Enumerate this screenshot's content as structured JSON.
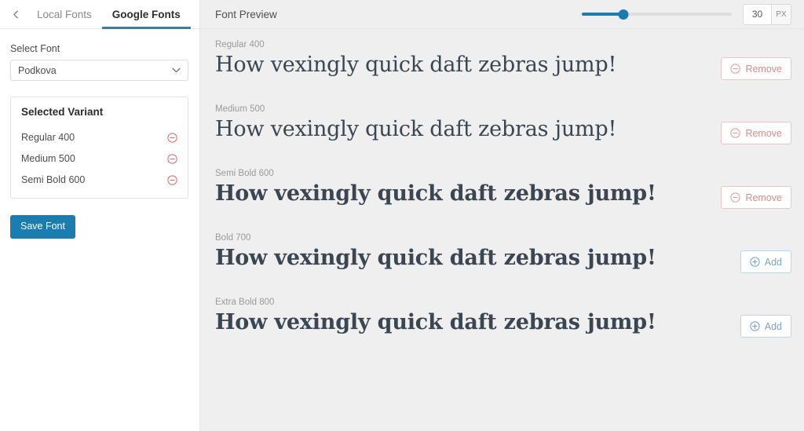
{
  "sidebar": {
    "back_icon": "chevron-left-icon",
    "tabs": [
      {
        "label": "Local Fonts",
        "active": false
      },
      {
        "label": "Google Fonts",
        "active": true
      }
    ],
    "select_font": {
      "label": "Select Font",
      "value": "Podkova",
      "placeholder": "Select Font",
      "chevron_icon": "chevron-down-icon"
    },
    "selected_variant": {
      "title": "Selected Variant",
      "remove_icon": "minus-circle-icon",
      "items": [
        {
          "label": "Regular 400"
        },
        {
          "label": "Medium 500"
        },
        {
          "label": "Semi Bold 600"
        }
      ]
    },
    "save_button": "Save Font"
  },
  "main": {
    "title": "Font Preview",
    "size_control": {
      "value": "30",
      "unit": "PX",
      "min": 0,
      "max": 100,
      "slider_percent": 28,
      "accent": "#1b7cb0"
    },
    "sample_text": "How vexingly quick daft zebras jump!",
    "add_label": "Add",
    "remove_label": "Remove",
    "add_icon": "plus-circle-icon",
    "remove_icon": "minus-circle-icon",
    "previews": [
      {
        "weight_label": "Regular 400",
        "css_weight": 400,
        "font_size_px": 27,
        "state": "added"
      },
      {
        "weight_label": "Medium 500",
        "css_weight": 500,
        "font_size_px": 27,
        "state": "added"
      },
      {
        "weight_label": "Semi Bold 600",
        "css_weight": 600,
        "font_size_px": 27,
        "state": "added"
      },
      {
        "weight_label": "Bold 700",
        "css_weight": 700,
        "font_size_px": 27,
        "state": "available"
      },
      {
        "weight_label": "Extra Bold 800",
        "css_weight": 800,
        "font_size_px": 27,
        "state": "available"
      }
    ]
  },
  "colors": {
    "accent_blue": "#1b7cb0",
    "tab_underline": "#3b7f9e",
    "remove_red": "#d98a8a",
    "panel_bg": "#efefef",
    "sidebar_bg": "#ffffff",
    "sample_text": "#3b4651"
  }
}
